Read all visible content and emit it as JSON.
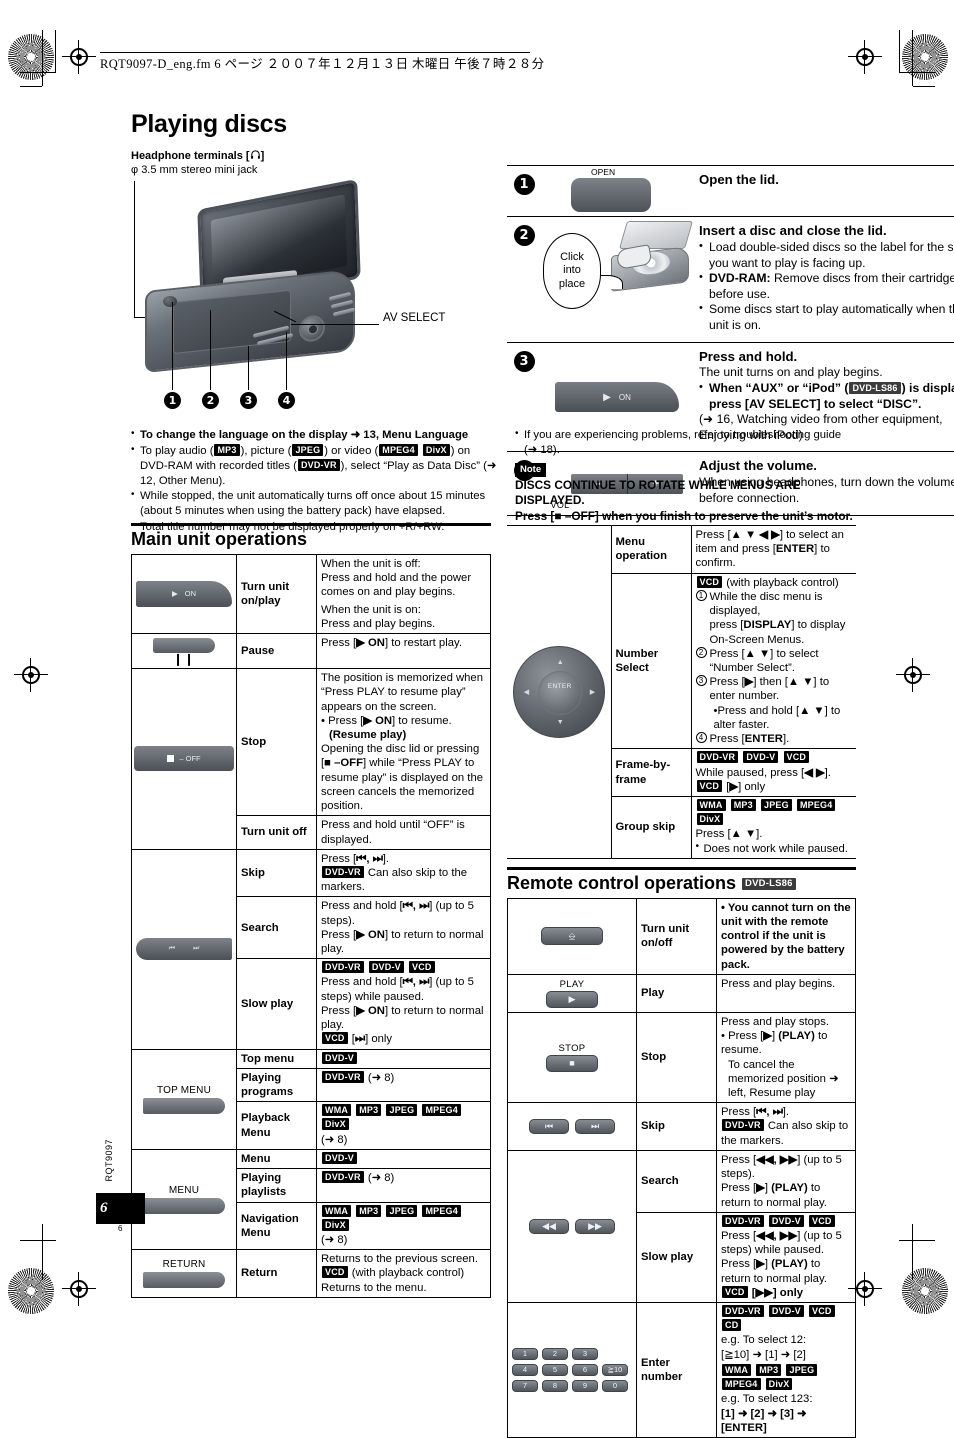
{
  "print_header": {
    "text": "RQT9097-D_eng.fm   6 ページ   ２００７年１２月１３日   木曜日   午後７時２８分"
  },
  "page_title": "Playing discs",
  "headphone": {
    "title": "Headphone terminals [",
    "title_end": "]",
    "subtitle": "φ 3.5 mm stereo mini jack"
  },
  "illustration": {
    "av_select_label": "AV SELECT",
    "callouts": [
      "1",
      "2",
      "3",
      "4"
    ]
  },
  "steps": [
    {
      "num": "1",
      "button_label": "OPEN",
      "heading": "Open the lid.",
      "lines": [],
      "bullets": []
    },
    {
      "num": "2",
      "bubble": [
        "Click",
        "into",
        "place"
      ],
      "heading": "Insert a disc and close the lid.",
      "bullets": [
        "Load double-sided discs so the label for the side you want to play is facing up.",
        "DVD-RAM: Remove discs from their cartridges before use.",
        "Some discs start to play automatically when the unit is on."
      ]
    },
    {
      "num": "3",
      "button_label": "ON",
      "heading": "Press and hold.",
      "sub": "The unit turns on and play begins.",
      "bullet_bold": "When “AUX” or “iPod” (",
      "bullet_tag": "DVD-LS86",
      "bullet_bold2": ") is displayed, press [AV SELECT] to select “DISC”.",
      "ref": "(➜ 16, Watching video from other equipment, Enjoying with iPod)"
    },
    {
      "num": "4",
      "vol_label": "VOL",
      "vol_minus": "–",
      "vol_plus": "+",
      "heading": "Adjust the volume.",
      "sub": "When using headphones, turn down the volume before connection."
    }
  ],
  "notes_left": [
    {
      "bold": true,
      "text": "To change the language on the display ➜ 13, Menu Language"
    },
    {
      "bold": false,
      "parts": [
        "To play audio (",
        "MP3",
        "), picture (",
        "JPEG",
        ") or video (",
        "MPEG4",
        "DivX",
        ") on DVD-RAM with recorded titles (",
        "DVD-VR",
        "), select “Play as Data Disc” (➜ 12, Other Menu)."
      ]
    },
    {
      "bold": false,
      "text": "While stopped, the unit automatically turns off once about 15 minutes (about 5 minutes when using the battery pack) have elapsed."
    },
    {
      "bold": false,
      "text": "Total title number may not be displayed properly on +R/+RW."
    }
  ],
  "notes_right": {
    "bullet": "If you are experiencing problems, refer to troubleshooting guide (➜ 18).",
    "note_badge": "Note",
    "note_line1": "DISCS CONTINUE TO ROTATE WHILE MENUS ARE DISPLAYED.",
    "note_line2": "Press [■ –OFF] when you finish to preserve the unit’s motor."
  },
  "main_unit": {
    "heading": "Main unit operations",
    "rows": [
      {
        "label": "Turn unit on/play",
        "pic": "on-button",
        "pic_text": "ON",
        "desc_lines": [
          "When the unit is off:",
          "Press and hold and the power comes on and play begins.",
          "When the unit is on:",
          "Press and play begins."
        ]
      },
      {
        "label": "Pause",
        "pic": "pause-button",
        "desc_lines": [
          "Press [▶ ON] to restart play."
        ]
      },
      {
        "label": "Stop",
        "pic": "stop-off-button",
        "pic_text": "– OFF",
        "desc_lines": [
          "The position is memorized when “Press PLAY to resume play” appears on the screen.",
          "• Press [▶ ON] to resume.",
          "(Resume play)",
          "Opening the disc lid or pressing [■ –OFF] while “Press PLAY to resume play” is displayed on the screen cancels the memorized position."
        ]
      },
      {
        "label": "Turn unit off",
        "desc_lines": [
          "Press and hold until “OFF” is displayed."
        ]
      },
      {
        "label": "Skip",
        "pic": "skip-button",
        "desc_lines": [
          "Press [⏮, ⏭].",
          "DVD-VR Can also skip to the markers."
        ]
      },
      {
        "label": "Search",
        "desc_lines": [
          "Press and hold [⏮, ⏭] (up to 5 steps).",
          "Press [▶ ON] to return to normal play."
        ]
      },
      {
        "label": "Slow play",
        "tags": [
          "DVD-VR",
          "DVD-V",
          "VCD"
        ],
        "desc_lines": [
          "Press and hold [⏮, ⏭] (up to 5 steps) while paused.",
          "Press [▶ ON] to return to normal play.",
          "VCD [⏭] only"
        ]
      },
      {
        "label": "Top menu",
        "pic_caption": "TOP MENU",
        "tags": [
          "DVD-V"
        ],
        "desc_lines": []
      },
      {
        "label": "Playing programs",
        "tags": [
          "DVD-VR"
        ],
        "desc_lines": [
          "(➜ 8)"
        ]
      },
      {
        "label": "Playback Menu",
        "tags": [
          "WMA",
          "MP3",
          "JPEG",
          "MPEG4",
          "DivX"
        ],
        "desc_lines": [
          "(➜ 8)"
        ]
      },
      {
        "label": "Menu",
        "pic_caption": "MENU",
        "tags": [
          "DVD-V"
        ],
        "desc_lines": []
      },
      {
        "label": "Playing playlists",
        "tags": [
          "DVD-VR"
        ],
        "desc_lines": [
          "(➜ 8)"
        ]
      },
      {
        "label": "Navigation Menu",
        "tags": [
          "WMA",
          "MP3",
          "JPEG",
          "MPEG4",
          "DivX"
        ],
        "desc_lines": [
          "(➜ 8)"
        ]
      },
      {
        "label": "Return",
        "pic_caption": "RETURN",
        "desc_lines": [
          "Returns to the previous screen.",
          "VCD (with playback control)",
          "Returns to the menu."
        ]
      }
    ],
    "right_rows": [
      {
        "label": "Menu operation",
        "desc_lines": [
          "Press [▲ ▼ ◀ ▶] to select an item and press [ENTER] to confirm."
        ]
      },
      {
        "label": "Number Select",
        "tag": "VCD",
        "tag_suffix": "(with playback control)",
        "steps": [
          "While the disc menu is displayed, press [DISPLAY] to display On-Screen Menus.",
          "Press [▲ ▼] to select “Number Select”.",
          "Press [▶] then [▲ ▼] to enter number.",
          "Press [ENTER]."
        ],
        "sub_bullet": "Press and hold [▲ ▼] to alter faster."
      },
      {
        "label": "Frame-by-frame",
        "tags": [
          "DVD-VR",
          "DVD-V",
          "VCD"
        ],
        "desc_lines": [
          "While paused, press [◀ ▶].",
          "VCD [▶] only"
        ]
      },
      {
        "label": "Group skip",
        "tags": [
          "WMA",
          "MP3",
          "JPEG",
          "MPEG4",
          "DivX"
        ],
        "desc_lines": [
          "Press [▲ ▼].",
          "• Does not work while paused."
        ]
      }
    ]
  },
  "remote": {
    "heading": "Remote control operations",
    "heading_tag": "DVD-LS86",
    "rows": [
      {
        "label": "Turn unit on/off",
        "pic": "power-button",
        "desc_bold": "• You cannot turn on the unit with the remote control if the unit is powered by the battery pack."
      },
      {
        "label": "Play",
        "pic_caption": "PLAY",
        "pic": "play-button",
        "desc_lines": [
          "Press and play begins."
        ]
      },
      {
        "label": "Stop",
        "pic_caption": "STOP",
        "pic": "stop-button",
        "desc_lines": [
          "Press and play stops.",
          "• Press [▶] (PLAY) to resume.",
          "To cancel the memorized position ➜ left, Resume play"
        ]
      },
      {
        "label": "Skip",
        "pic": "skip-buttons",
        "desc_lines": [
          "Press [⏮, ⏭].",
          "DVD-VR Can also skip to the markers."
        ]
      },
      {
        "label": "Search",
        "desc_lines": [
          "Press [◀◀, ▶▶] (up to 5 steps).",
          "Press [▶] (PLAY) to return to normal play."
        ]
      },
      {
        "label": "Slow play",
        "pic": "search-buttons",
        "tags": [
          "DVD-VR",
          "DVD-V",
          "VCD"
        ],
        "desc_lines": [
          "Press [◀◀, ▶▶] (up to 5 steps) while paused.",
          "Press [▶] (PLAY) to return to normal play.",
          "VCD [▶▶] only"
        ]
      },
      {
        "label": "Enter number",
        "pic": "number-pad",
        "keys": [
          "1",
          "2",
          "3",
          "4",
          "5",
          "6",
          "≧10",
          "7",
          "8",
          "9",
          "0"
        ],
        "tags1": [
          "DVD-VR",
          "DVD-V",
          "VCD",
          "CD"
        ],
        "line1": "e.g. To select 12:",
        "line2": "[≧10] ➜ [1] ➜ [2]",
        "tags2": [
          "WMA",
          "MP3",
          "JPEG",
          "MPEG4",
          "DivX"
        ],
        "line3": "e.g. To select 123:",
        "line4": "[1] ➜ [2] ➜ [3] ➜ [ENTER]"
      }
    ]
  },
  "footer": {
    "product_code": "RQT9097",
    "page_number": "6",
    "page_number_small": "6"
  }
}
